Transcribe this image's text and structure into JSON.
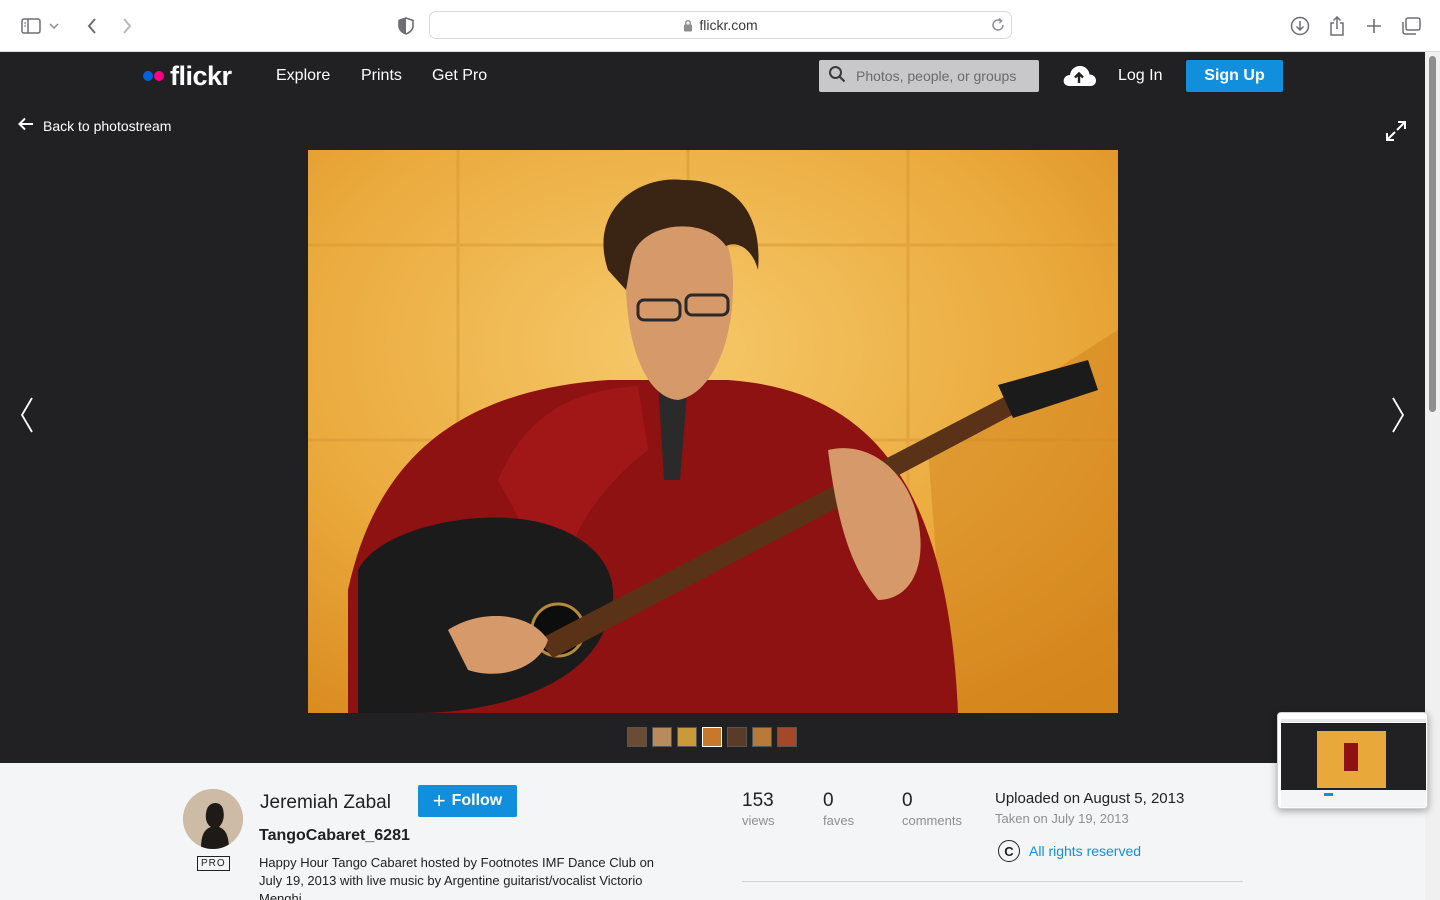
{
  "browser": {
    "url": "flickr.com",
    "icons": [
      "sidebar-icon",
      "chevron-down-icon",
      "back-icon",
      "forward-icon",
      "privacy-shield-icon",
      "lock-icon",
      "reload-icon",
      "download-icon",
      "share-icon",
      "new-tab-icon",
      "tabs-overview-icon"
    ]
  },
  "header": {
    "logo_text": "flickr",
    "logo_colors": [
      "#0063dc",
      "#ff0084"
    ],
    "nav": [
      "Explore",
      "Prints",
      "Get Pro"
    ],
    "search_placeholder": "Photos, people, or groups",
    "login_label": "Log In",
    "signup_label": "Sign Up",
    "accent": "#128fdc"
  },
  "photo_view": {
    "back_label": "Back to photostream",
    "thumbnail_count": 7
  },
  "info": {
    "owner_name": "Jeremiah Zabal",
    "pro_badge": "PRO",
    "follow_label": "Follow",
    "photo_title": "TangoCabaret_6281",
    "description": "Happy Hour Tango Cabaret hosted by Footnotes IMF Dance Club on July 19, 2013 with live music by Argentine guitarist/vocalist Victorio Menghi",
    "stats": [
      {
        "value": "153",
        "label": "views"
      },
      {
        "value": "0",
        "label": "faves"
      },
      {
        "value": "0",
        "label": "comments"
      }
    ],
    "uploaded": "Uploaded on August 5, 2013",
    "taken": "Taken on July 19, 2013",
    "license_symbol": "C",
    "license": "All rights reserved"
  }
}
